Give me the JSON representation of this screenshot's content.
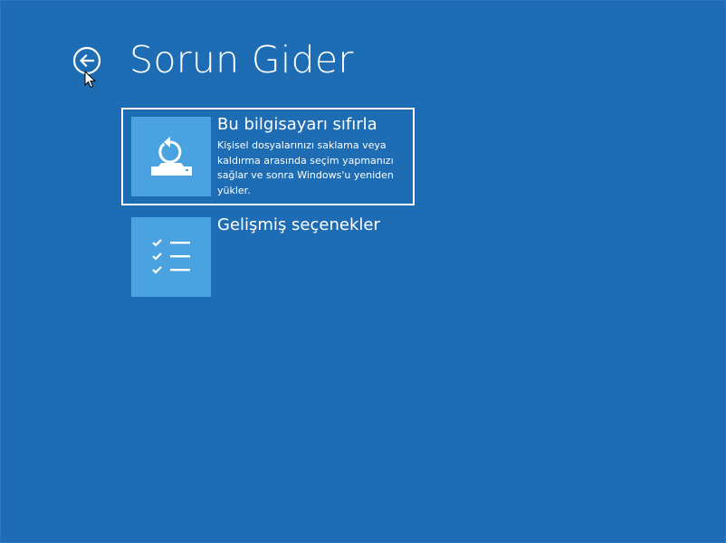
{
  "header": {
    "title": "Sorun Gider",
    "back_icon": "back-arrow-circle-icon"
  },
  "options": [
    {
      "title": "Bu bilgisayarı sıfırla",
      "description": "Kişisel dosyalarınızı saklama veya kaldırma arasında seçim yapmanızı sağlar ve sonra Windows'u yeniden yükler.",
      "icon": "reset-pc-icon",
      "selected": true
    },
    {
      "title": "Gelişmiş seçenekler",
      "icon": "checklist-icon",
      "selected": false
    }
  ],
  "colors": {
    "background": "#1e6cb3",
    "tile": "#4aa3e0",
    "text": "#ffffff"
  }
}
